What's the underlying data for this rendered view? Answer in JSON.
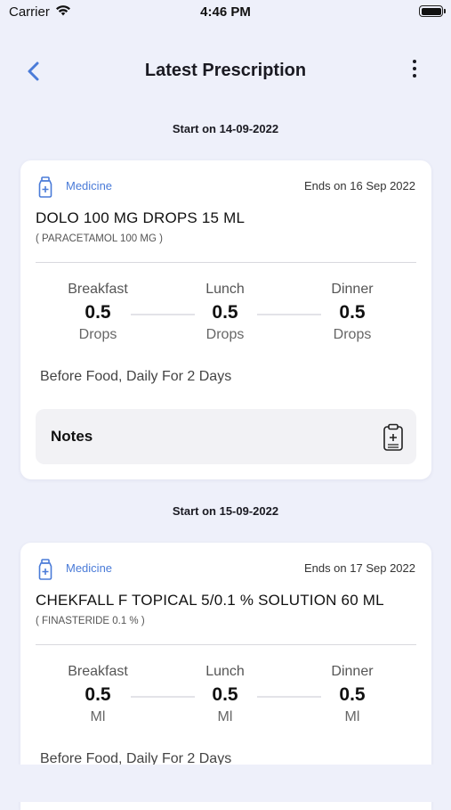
{
  "status": {
    "carrier": "Carrier",
    "time": "4:46 PM"
  },
  "nav": {
    "title": "Latest Prescription"
  },
  "prescriptions": [
    {
      "start": "Start on 14-09-2022",
      "type": "Medicine",
      "ends": "Ends on 16 Sep 2022",
      "name": "DOLO 100 MG DROPS 15 ML",
      "generic": "( PARACETAMOL 100 MG )",
      "doses": [
        {
          "meal": "Breakfast",
          "qty": "0.5",
          "unit": "Drops"
        },
        {
          "meal": "Lunch",
          "qty": "0.5",
          "unit": "Drops"
        },
        {
          "meal": "Dinner",
          "qty": "0.5",
          "unit": "Drops"
        }
      ],
      "instruction": "Before Food, Daily For 2 Days",
      "notes_label": "Notes"
    },
    {
      "start": "Start on 15-09-2022",
      "type": "Medicine",
      "ends": "Ends on 17 Sep 2022",
      "name": "CHEKFALL F TOPICAL 5/0.1 % SOLUTION 60 ML",
      "generic": "( FINASTERIDE 0.1 % )",
      "doses": [
        {
          "meal": "Breakfast",
          "qty": "0.5",
          "unit": "Ml"
        },
        {
          "meal": "Lunch",
          "qty": "0.5",
          "unit": "Ml"
        },
        {
          "meal": "Dinner",
          "qty": "0.5",
          "unit": "Ml"
        }
      ],
      "instruction": "Before Food, Daily For 2 Days"
    }
  ],
  "colors": {
    "accent": "#4a7bd8",
    "background": "#eef0fa",
    "card": "#ffffff"
  },
  "icons": {
    "back": "chevron-left-icon",
    "more": "more-vertical-icon",
    "medicine": "medicine-bottle-icon",
    "notes": "clipboard-icon"
  }
}
